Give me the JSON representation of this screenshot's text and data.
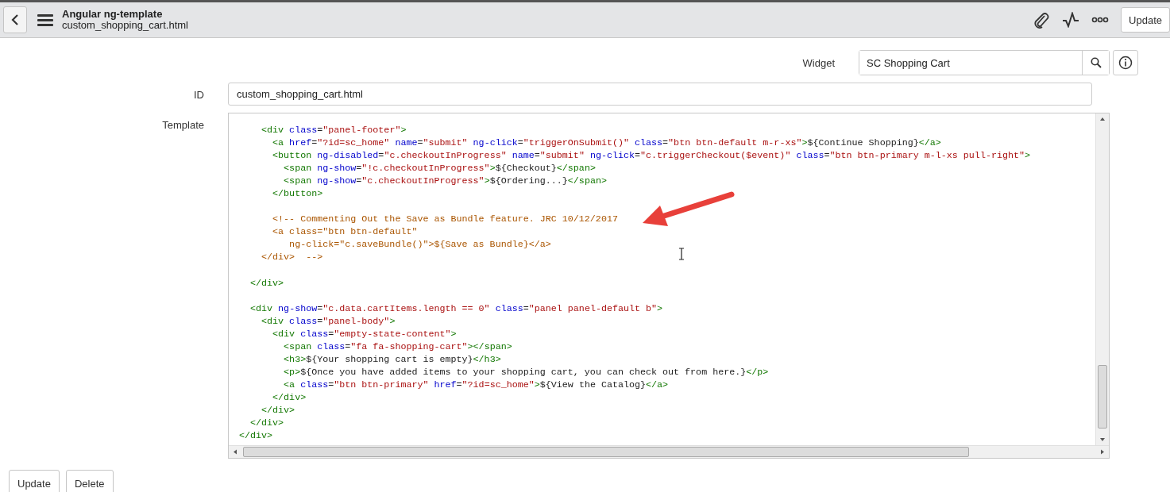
{
  "header": {
    "title": "Angular ng-template",
    "subtitle": "custom_shopping_cart.html",
    "action_button": "Update"
  },
  "widget_field": {
    "label": "Widget",
    "value": "SC Shopping Cart"
  },
  "id_field": {
    "label": "ID",
    "value": "custom_shopping_cart.html"
  },
  "template": {
    "label": "Template",
    "lines": [
      {
        "kind": "code",
        "tokens": [
          {
            "kind": "tag",
            "text": "    <div"
          },
          {
            "kind": "attr",
            "text": " class"
          },
          {
            "kind": "text",
            "text": "="
          },
          {
            "kind": "string",
            "text": "\"panel-footer\""
          },
          {
            "kind": "tag",
            "text": ">"
          }
        ]
      },
      {
        "kind": "code",
        "tokens": [
          {
            "kind": "tag",
            "text": "      <a"
          },
          {
            "kind": "attr",
            "text": " href"
          },
          {
            "kind": "text",
            "text": "="
          },
          {
            "kind": "string",
            "text": "\"?id=sc_home\""
          },
          {
            "kind": "attr",
            "text": " name"
          },
          {
            "kind": "text",
            "text": "="
          },
          {
            "kind": "string",
            "text": "\"submit\""
          },
          {
            "kind": "attr",
            "text": " ng-click"
          },
          {
            "kind": "text",
            "text": "="
          },
          {
            "kind": "string",
            "text": "\"triggerOnSubmit()\""
          },
          {
            "kind": "attr",
            "text": " class"
          },
          {
            "kind": "text",
            "text": "="
          },
          {
            "kind": "string",
            "text": "\"btn btn-default m-r-xs\""
          },
          {
            "kind": "tag",
            "text": ">"
          },
          {
            "kind": "text",
            "text": "${Continue Shopping}"
          },
          {
            "kind": "tag",
            "text": "</a>"
          }
        ]
      },
      {
        "kind": "code",
        "tokens": [
          {
            "kind": "tag",
            "text": "      <button"
          },
          {
            "kind": "attr",
            "text": " ng-disabled"
          },
          {
            "kind": "text",
            "text": "="
          },
          {
            "kind": "string",
            "text": "\"c.checkoutInProgress\""
          },
          {
            "kind": "attr",
            "text": " name"
          },
          {
            "kind": "text",
            "text": "="
          },
          {
            "kind": "string",
            "text": "\"submit\""
          },
          {
            "kind": "attr",
            "text": " ng-click"
          },
          {
            "kind": "text",
            "text": "="
          },
          {
            "kind": "string",
            "text": "\"c.triggerCheckout($event)\""
          },
          {
            "kind": "attr",
            "text": " class"
          },
          {
            "kind": "text",
            "text": "="
          },
          {
            "kind": "string",
            "text": "\"btn btn-primary m-l-xs pull-right\""
          },
          {
            "kind": "tag",
            "text": ">"
          }
        ]
      },
      {
        "kind": "code",
        "tokens": [
          {
            "kind": "tag",
            "text": "        <span"
          },
          {
            "kind": "attr",
            "text": " ng-show"
          },
          {
            "kind": "text",
            "text": "="
          },
          {
            "kind": "string",
            "text": "\"!c.checkoutInProgress\""
          },
          {
            "kind": "tag",
            "text": ">"
          },
          {
            "kind": "text",
            "text": "${Checkout}"
          },
          {
            "kind": "tag",
            "text": "</span>"
          }
        ]
      },
      {
        "kind": "code",
        "tokens": [
          {
            "kind": "tag",
            "text": "        <span"
          },
          {
            "kind": "attr",
            "text": " ng-show"
          },
          {
            "kind": "text",
            "text": "="
          },
          {
            "kind": "string",
            "text": "\"c.checkoutInProgress\""
          },
          {
            "kind": "tag",
            "text": ">"
          },
          {
            "kind": "text",
            "text": "${Ordering...}"
          },
          {
            "kind": "tag",
            "text": "</span>"
          }
        ]
      },
      {
        "kind": "code",
        "tokens": [
          {
            "kind": "tag",
            "text": "      </button>"
          }
        ]
      },
      {
        "kind": "blank"
      },
      {
        "kind": "code",
        "tokens": [
          {
            "kind": "comment",
            "text": "      <!-- Commenting Out the Save as Bundle feature. JRC 10/12/2017"
          }
        ]
      },
      {
        "kind": "code",
        "tokens": [
          {
            "kind": "comment",
            "text": "      <a class=\"btn btn-default\""
          }
        ]
      },
      {
        "kind": "code",
        "tokens": [
          {
            "kind": "comment",
            "text": "         ng-click=\"c.saveBundle()\">${Save as Bundle}</a>"
          }
        ]
      },
      {
        "kind": "code",
        "tokens": [
          {
            "kind": "comment",
            "text": "    </div>  -->"
          }
        ]
      },
      {
        "kind": "blank"
      },
      {
        "kind": "code",
        "tokens": [
          {
            "kind": "tag",
            "text": "  </div>"
          }
        ]
      },
      {
        "kind": "blank"
      },
      {
        "kind": "code",
        "tokens": [
          {
            "kind": "tag",
            "text": "  <div"
          },
          {
            "kind": "attr",
            "text": " ng-show"
          },
          {
            "kind": "text",
            "text": "="
          },
          {
            "kind": "string",
            "text": "\"c.data.cartItems.length == 0\""
          },
          {
            "kind": "attr",
            "text": " class"
          },
          {
            "kind": "text",
            "text": "="
          },
          {
            "kind": "string",
            "text": "\"panel panel-default b\""
          },
          {
            "kind": "tag",
            "text": ">"
          }
        ]
      },
      {
        "kind": "code",
        "tokens": [
          {
            "kind": "tag",
            "text": "    <div"
          },
          {
            "kind": "attr",
            "text": " class"
          },
          {
            "kind": "text",
            "text": "="
          },
          {
            "kind": "string",
            "text": "\"panel-body\""
          },
          {
            "kind": "tag",
            "text": ">"
          }
        ]
      },
      {
        "kind": "code",
        "tokens": [
          {
            "kind": "tag",
            "text": "      <div"
          },
          {
            "kind": "attr",
            "text": " class"
          },
          {
            "kind": "text",
            "text": "="
          },
          {
            "kind": "string",
            "text": "\"empty-state-content\""
          },
          {
            "kind": "tag",
            "text": ">"
          }
        ]
      },
      {
        "kind": "code",
        "tokens": [
          {
            "kind": "tag",
            "text": "        <span"
          },
          {
            "kind": "attr",
            "text": " class"
          },
          {
            "kind": "text",
            "text": "="
          },
          {
            "kind": "string",
            "text": "\"fa fa-shopping-cart\""
          },
          {
            "kind": "tag",
            "text": "></span>"
          }
        ]
      },
      {
        "kind": "code",
        "tokens": [
          {
            "kind": "tag",
            "text": "        <h3>"
          },
          {
            "kind": "text",
            "text": "${Your shopping cart is empty}"
          },
          {
            "kind": "tag",
            "text": "</h3>"
          }
        ]
      },
      {
        "kind": "code",
        "tokens": [
          {
            "kind": "tag",
            "text": "        <p>"
          },
          {
            "kind": "text",
            "text": "${Once you have added items to your shopping cart, you can check out from here.}"
          },
          {
            "kind": "tag",
            "text": "</p>"
          }
        ]
      },
      {
        "kind": "code",
        "tokens": [
          {
            "kind": "tag",
            "text": "        <a"
          },
          {
            "kind": "attr",
            "text": " class"
          },
          {
            "kind": "text",
            "text": "="
          },
          {
            "kind": "string",
            "text": "\"btn btn-primary\""
          },
          {
            "kind": "attr",
            "text": " href"
          },
          {
            "kind": "text",
            "text": "="
          },
          {
            "kind": "string",
            "text": "\"?id=sc_home\""
          },
          {
            "kind": "tag",
            "text": ">"
          },
          {
            "kind": "text",
            "text": "${View the Catalog}"
          },
          {
            "kind": "tag",
            "text": "</a>"
          }
        ]
      },
      {
        "kind": "code",
        "tokens": [
          {
            "kind": "tag",
            "text": "      </div>"
          }
        ]
      },
      {
        "kind": "code",
        "tokens": [
          {
            "kind": "tag",
            "text": "    </div>"
          }
        ]
      },
      {
        "kind": "code",
        "tokens": [
          {
            "kind": "tag",
            "text": "  </div>"
          }
        ]
      },
      {
        "kind": "code",
        "tokens": [
          {
            "kind": "tag",
            "text": "</div>"
          }
        ]
      }
    ]
  },
  "buttons": [
    "Update",
    "Delete"
  ]
}
